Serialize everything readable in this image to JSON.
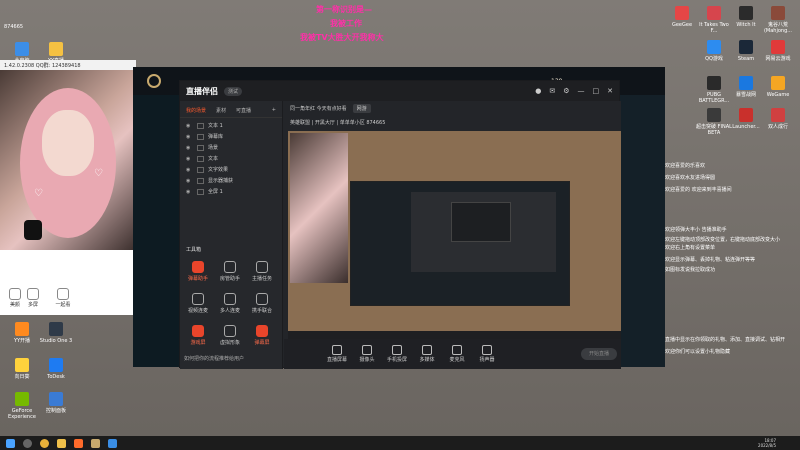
{
  "overlay": {
    "line1": "第一称识别是—",
    "line2": "我被工作",
    "line3": "我被TV大胜大开我称大"
  },
  "desktop": {
    "top_label": "874665",
    "left_icons": [
      {
        "label": "此电脑",
        "color": "#3c8ee8"
      },
      {
        "label": "YY直播",
        "color": "#f5c142"
      },
      {
        "label": "YY开播",
        "color": "#ff8a1f"
      },
      {
        "label": "Studio One 3",
        "color": "#2f3a48"
      },
      {
        "label": "向日葵",
        "color": "#ffd23c"
      },
      {
        "label": "ToDesk",
        "color": "#1e7bf2"
      },
      {
        "label": "GeForce Experience",
        "color": "#76b900"
      },
      {
        "label": "控制面板",
        "color": "#3a7bd5"
      }
    ],
    "right_icons": [
      {
        "label": "GeeGee",
        "color": "#e54646"
      },
      {
        "label": "It Takes Two F...",
        "color": "#d6454d"
      },
      {
        "label": "Witch It",
        "color": "#2b2b2b"
      },
      {
        "label": "鬼谷八荒 (Mahjong...",
        "color": "#8a4a3a"
      },
      {
        "label": "QQ游戏",
        "color": "#2d8cf0"
      },
      {
        "label": "Steam",
        "color": "#1b2838"
      },
      {
        "label": "网易云游戏",
        "color": "#e03a3a"
      },
      {
        "label": "PUBG BATTLEGR...",
        "color": "#2a2a2a"
      },
      {
        "label": "暴雪战网",
        "color": "#1a78e0"
      },
      {
        "label": "WeGame",
        "color": "#f5a623"
      },
      {
        "label": "超击突破 FINAL BETA",
        "color": "#3a3a3a"
      },
      {
        "label": "Launcher...",
        "color": "#c9302c"
      },
      {
        "label": "双人成行",
        "color": "#d04040"
      }
    ]
  },
  "cam": {
    "address": "1.42.0.2308  QQ群: 124389418",
    "buttons": [
      "美颜",
      "多屏",
      "一起看"
    ]
  },
  "lol": {
    "level": "139"
  },
  "app": {
    "title": "直播伴侣",
    "version": "测试",
    "left_tabs": [
      "我的场景",
      "素材",
      "可直播"
    ],
    "scenes": [
      "文本 1",
      "弹幕库",
      "场景",
      "文本",
      "文字效果",
      "显示器捕获",
      "全屏 1"
    ],
    "tools_header": "工具箱",
    "tools": [
      "弹幕助手",
      "房管助手",
      "主播任务",
      "视频连麦",
      "多人连麦",
      "携手联合",
      "游戏屏",
      "虚拟形象",
      "弹幕屏"
    ],
    "notice": "如何把你的流程推荐给用户",
    "room_title": "同一角年红 今天有点好看",
    "room_tag": "网游",
    "room_extra": "英雄联盟 | 开黑大厅 | 单单单小区 874665",
    "bottom_buttons": [
      "直播屏幕",
      "摄像头",
      "手机投屏",
      "多媒体",
      "麦克风",
      "扬声器"
    ],
    "start_label": "开始直播"
  },
  "chat": {
    "messages": [
      "欢迎喜爱的乐喜欢",
      "欢迎喜欢水友进场得圆",
      "欢迎喜爱的 欢迎来到丰喜播间",
      "欢迎领弹大丰小 告播准助手",
      "欢迎左键拖动顶部改变位置，右键拖动底部改变大小",
      "欢迎右上角有设置菜单",
      "欢迎显示弹幕、丢掉礼物、粘连弹开等等",
      "如图标发说我拉取成功",
      "直播中显示在你领取的礼物、添加、直接调试、钻相开",
      "欢迎你们可以设置小礼物隐藏"
    ]
  },
  "taskbar": {
    "time": "18:07",
    "date": "2022/8/5"
  }
}
